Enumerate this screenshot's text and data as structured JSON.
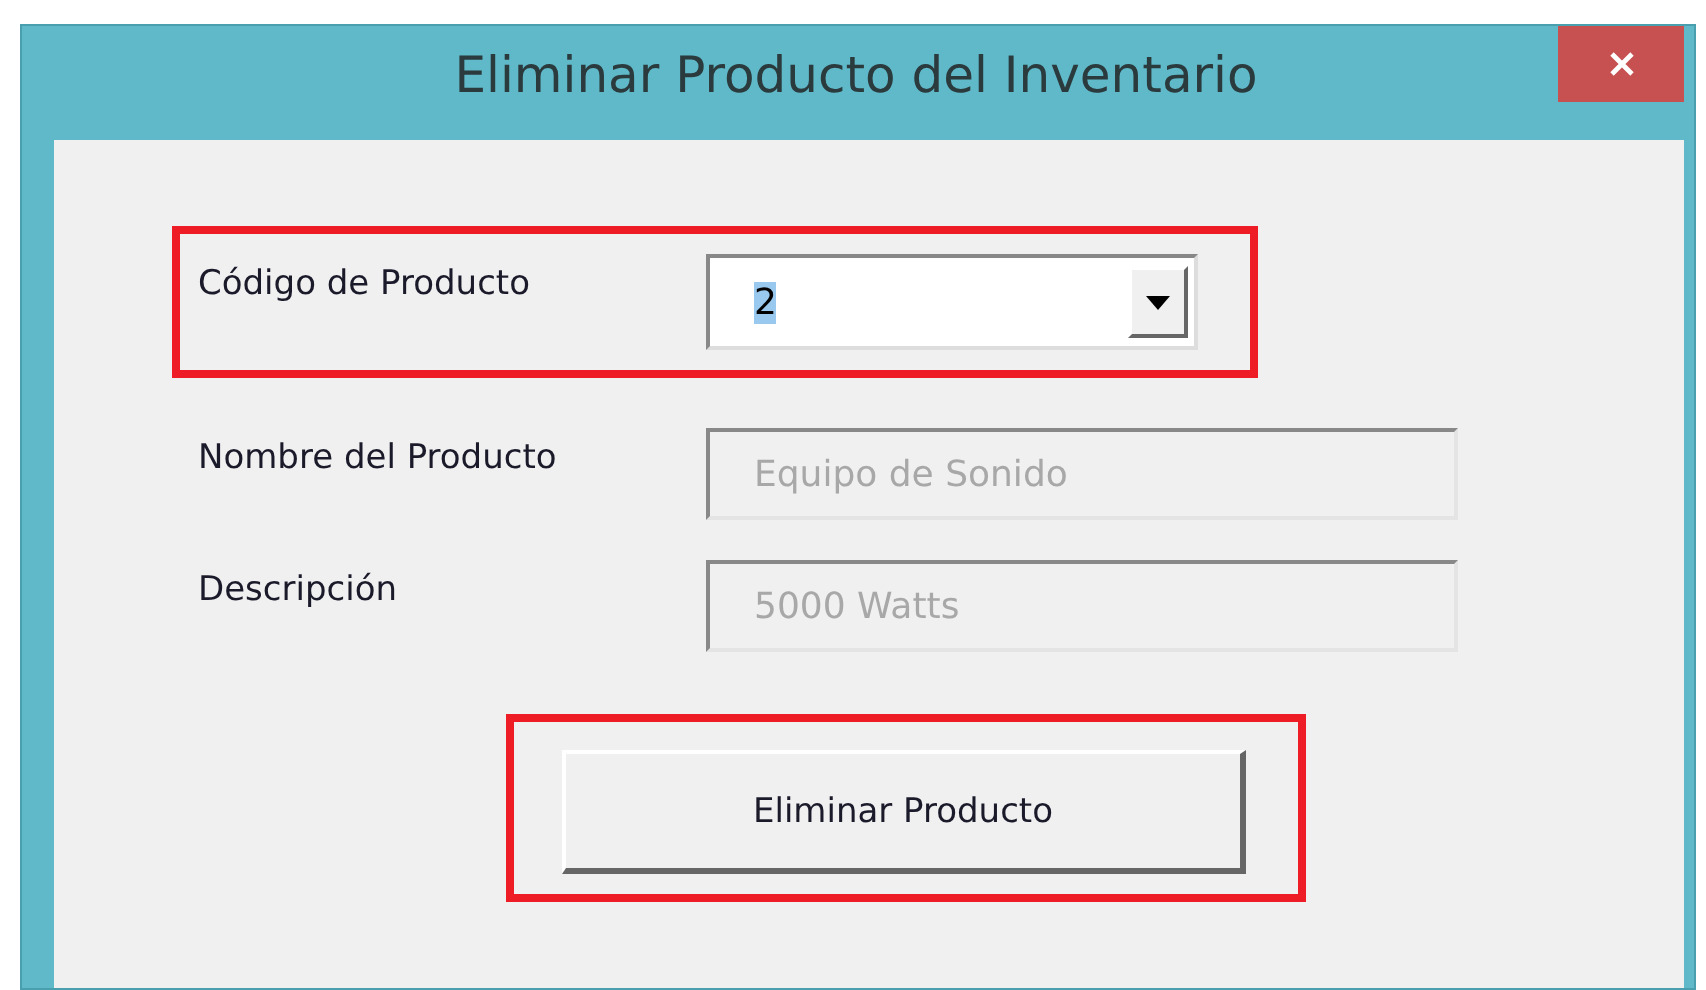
{
  "window": {
    "title": "Eliminar Producto del Inventario"
  },
  "fields": [
    {
      "label": "Código de Producto",
      "kind": "combo",
      "value": "2",
      "disabled": false,
      "focused": true,
      "highlighted": true
    },
    {
      "label": "Nombre del Producto",
      "kind": "text",
      "value": "Equipo de Sonido",
      "disabled": true,
      "focused": false,
      "highlighted": false
    },
    {
      "label": "Descripción",
      "kind": "text",
      "value": "5000 Watts",
      "disabled": true,
      "focused": false,
      "highlighted": false
    }
  ],
  "button": {
    "label": "Eliminar Producto",
    "highlighted": true
  }
}
